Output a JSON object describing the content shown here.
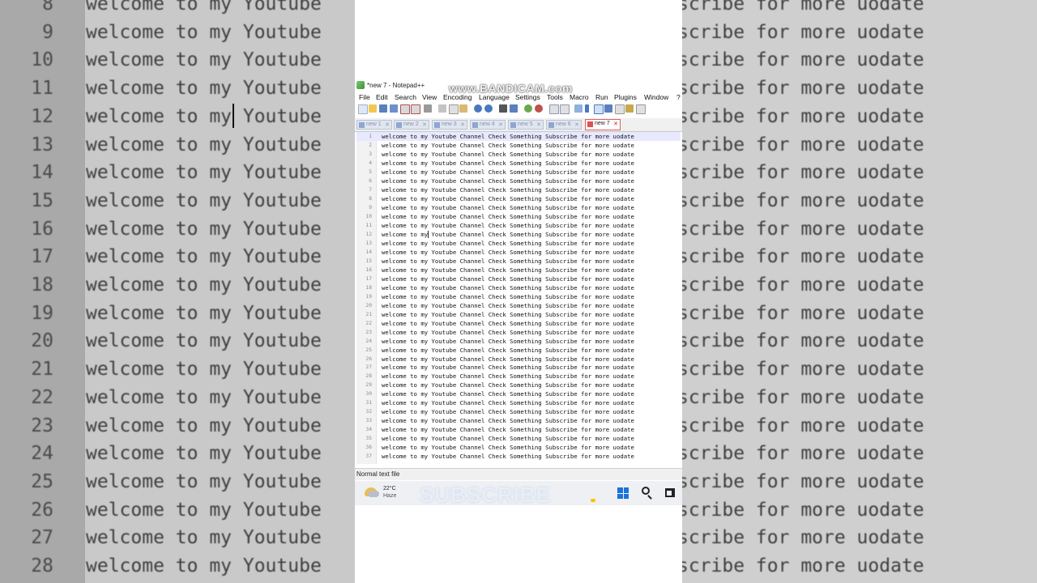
{
  "window": {
    "title": "*new 7 - Notepad++",
    "watermark": "www.BANDICAM.com"
  },
  "menu": [
    "File",
    "Edit",
    "Search",
    "View",
    "Encoding",
    "Language",
    "Settings",
    "Tools",
    "Macro",
    "Run",
    "Plugins",
    "Window",
    "?"
  ],
  "tabs": [
    {
      "label": "new 1",
      "active": false
    },
    {
      "label": "new 2",
      "active": false
    },
    {
      "label": "new 3",
      "active": false
    },
    {
      "label": "new 4",
      "active": false
    },
    {
      "label": "new 5",
      "active": false
    },
    {
      "label": "new 6",
      "active": false
    },
    {
      "label": "new 7",
      "active": true
    }
  ],
  "editor": {
    "line_text": "welcome to my Youtube Channel Check Something Subscribe for more uodate",
    "line_count": 37,
    "current_line": 1
  },
  "status": {
    "file_type": "Normal text file"
  },
  "taskbar": {
    "temperature": "22°C",
    "condition": "Haze",
    "overlay_text": "SUBSCRIBE"
  },
  "background": {
    "line_numbers": [
      "8",
      "9",
      "10",
      "11",
      "12",
      "13",
      "14",
      "15",
      "16",
      "17",
      "18",
      "19",
      "20",
      "21",
      "22",
      "23",
      "24",
      "25",
      "26",
      "27",
      "28"
    ],
    "left_text": "welcome to my Youtube",
    "right_text": "scribe for more uodate"
  },
  "colors": {
    "active_tab_border": "#e06060",
    "current_line": "#e8e8ff",
    "windows_blue": "#1a73d9"
  }
}
